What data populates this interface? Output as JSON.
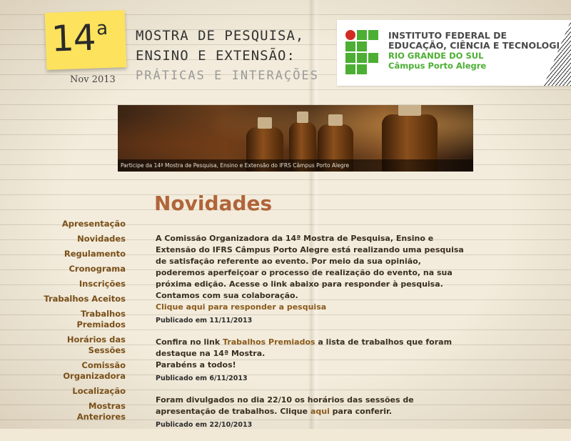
{
  "header": {
    "sticky_number": "14",
    "sticky_sup": "a",
    "date": "Nov 2013",
    "event_line1": "MOSTRA DE PESQUISA,",
    "event_line2": "ENSINO E EXTENSÃO:",
    "event_line3": "PRÁTICAS E INTERAÇÕES"
  },
  "institution": {
    "line1": "INSTITUTO FEDERAL DE",
    "line2": "EDUCAÇÃO, CIÊNCIA E TECNOLOGIA",
    "line3": "RIO GRANDE DO SUL",
    "line4": "Câmpus Porto Alegre",
    "colors": {
      "green": "#4caf34",
      "red": "#d42a24"
    }
  },
  "banner": {
    "caption": "Participe da 14ª Mostra de Pesquisa, Ensino e Extensão do IFRS Câmpus Porto Alegre"
  },
  "page_title": "Novidades",
  "sidebar": {
    "items": [
      {
        "label": "Apresentação"
      },
      {
        "label": "Novidades"
      },
      {
        "label": "Regulamento"
      },
      {
        "label": "Cronograma"
      },
      {
        "label": "Inscrições"
      },
      {
        "label": "Trabalhos Aceitos"
      },
      {
        "label": "Trabalhos Premiados"
      },
      {
        "label": "Horários das Sessões"
      },
      {
        "label": "Comissão Organizadora"
      },
      {
        "label": "Localização"
      },
      {
        "label": "Mostras Anteriores"
      }
    ]
  },
  "news": [
    {
      "text": "A Comissão Organizadora da 14ª Mostra de Pesquisa, Ensino e Extensão do IFRS Câmpus Porto Alegre está realizando uma pesquisa de satisfação referente ao evento. Por meio da sua opinião, poderemos aperfeiçoar o processo de realização do evento, na sua próxima edição. Acesse o link abaixo para responder à pesquisa. Contamos com sua colaboração.",
      "link": "Clique aqui para responder a pesquisa",
      "published": "Publicado em 11/11/2013"
    },
    {
      "pre": "Confira no link ",
      "link": "Trabalhos Premiados",
      "post": " a lista de trabalhos que foram destaque na 14ª Mostra.",
      "extra": "Parabéns a todos!",
      "published": "Publicado em 6/11/2013"
    },
    {
      "pre": "Foram divulgados no dia 22/10 os horários das sessões de apresentação de trabalhos. Clique ",
      "link": "aqui",
      "post": " para conferir.",
      "published": "Publicado em 22/10/2013"
    }
  ],
  "colors": {
    "accent": "#b0653a",
    "link": "#7a5019",
    "sticky": "#fde25e"
  }
}
